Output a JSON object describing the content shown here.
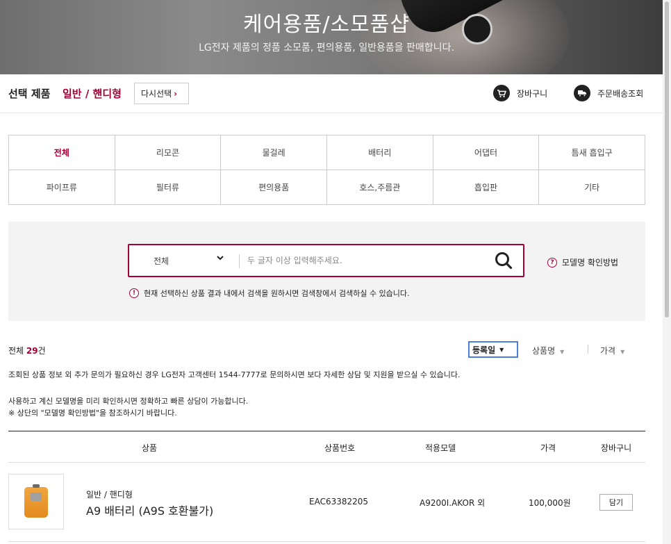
{
  "hero": {
    "title": "케어용품/소모품샵",
    "subtitle": "LG전자 제품의 정품 소모품, 편의용품, 일반용품을 판매합니다."
  },
  "selection": {
    "label": "선택 제품",
    "value": "일반 / 핸디형",
    "reselect_label": "다시선택",
    "cart_label": "장바구니",
    "order_label": "주문배송조회"
  },
  "categories": [
    {
      "label": "전체",
      "active": true
    },
    {
      "label": "리모콘"
    },
    {
      "label": "물걸레"
    },
    {
      "label": "배터리"
    },
    {
      "label": "어댑터"
    },
    {
      "label": "틈새 흡입구"
    },
    {
      "label": "파이프류"
    },
    {
      "label": "필터류"
    },
    {
      "label": "편의용품"
    },
    {
      "label": "호스,주름관"
    },
    {
      "label": "흡입판"
    },
    {
      "label": "기타"
    }
  ],
  "search": {
    "scope": "전체",
    "placeholder": "두 글자 이상 입력해주세요.",
    "model_help": "모델명 확인방법",
    "note": "현재 선택하신 상품 결과 내에서 검색을 원하시면 검색창에서 검색하실 수 있습니다."
  },
  "results": {
    "count_prefix": "전체 ",
    "count": "29",
    "count_suffix": "건",
    "sort": {
      "active": "등록일",
      "options": [
        "상품명",
        "가격"
      ]
    },
    "info_line1": "조회된 상품 정보 외 추가 문의가 필요하신 경우 LG전자 고객센터 1544-7777로 문의하시면 보다 자세한 상담 및 지원을 받으실 수 있습니다.",
    "info_line2": "사용하고 계신 모델명을 미리 확인하시면 정확하고 빠른 상담이 가능합니다.",
    "info_line3": "※ 상단의 \"모델명 확인방법\"을 참조하시기 바랍니다."
  },
  "table": {
    "headers": {
      "product": "상품",
      "part_no": "상품번호",
      "model": "적용모델",
      "price": "가격",
      "cart": "장바구니"
    },
    "rows": [
      {
        "category": "일반 / 핸디형",
        "name": "A9 배터리 (A9S 호환불가)",
        "part_no": "EAC63382205",
        "model": "A9200I.AKOR 외",
        "price": "100,000원",
        "cart_btn": "담기"
      }
    ]
  },
  "icons": {
    "cart": "cart-icon",
    "truck": "truck-icon",
    "search": "search-icon",
    "question": "question-icon",
    "alert": "alert-icon"
  },
  "colors": {
    "accent": "#a50034",
    "sort_focus": "#4a80d8"
  }
}
